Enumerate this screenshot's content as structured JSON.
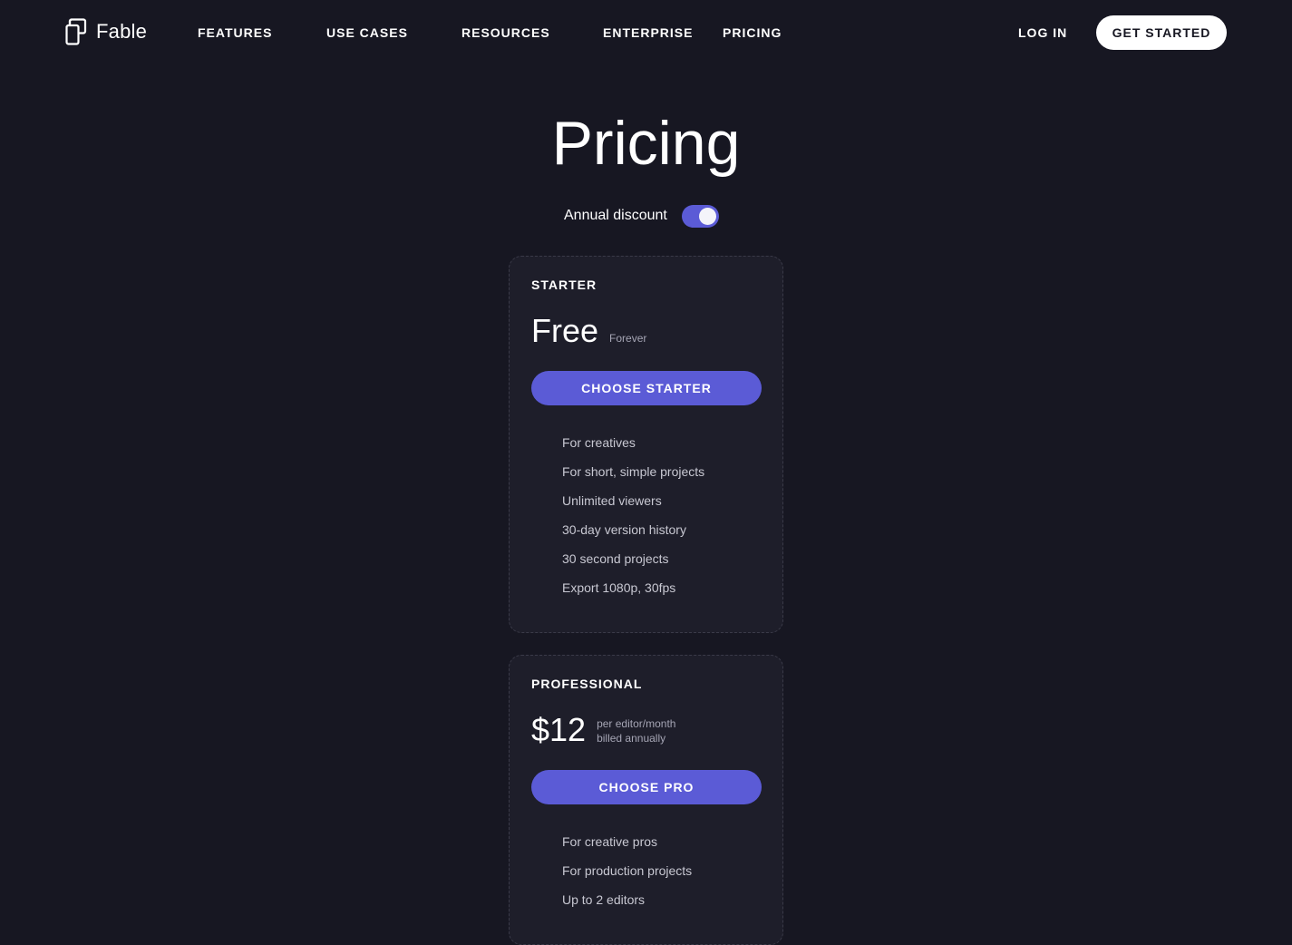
{
  "brand": {
    "name": "Fable",
    "logo_icon": "fable-logo-icon"
  },
  "nav": {
    "links": [
      {
        "label": "FEATURES"
      },
      {
        "label": "USE CASES"
      },
      {
        "label": "RESOURCES"
      },
      {
        "label": "ENTERPRISE"
      },
      {
        "label": "PRICING"
      }
    ],
    "login_label": "LOG IN",
    "cta_label": "GET STARTED"
  },
  "page": {
    "title": "Pricing",
    "discount_label": "Annual discount",
    "discount_enabled": true
  },
  "colors": {
    "background": "#171722",
    "card": "#1e1e2a",
    "accent": "#5b5bd6",
    "text": "#ffffff",
    "muted": "#c8c8d2"
  },
  "plans": [
    {
      "name": "STARTER",
      "price": "Free",
      "price_note_line1": "Forever",
      "price_note_line2": "",
      "button_label": "CHOOSE STARTER",
      "features": [
        "For creatives",
        "For short, simple projects",
        "Unlimited viewers",
        "30-day version history",
        "30 second projects",
        "Export 1080p, 30fps"
      ]
    },
    {
      "name": "PROFESSIONAL",
      "price": "$12",
      "price_note_line1": "per editor/month",
      "price_note_line2": "billed annually",
      "button_label": "CHOOSE PRO",
      "features": [
        "For creative pros",
        "For production projects",
        "Up to 2 editors"
      ]
    }
  ]
}
